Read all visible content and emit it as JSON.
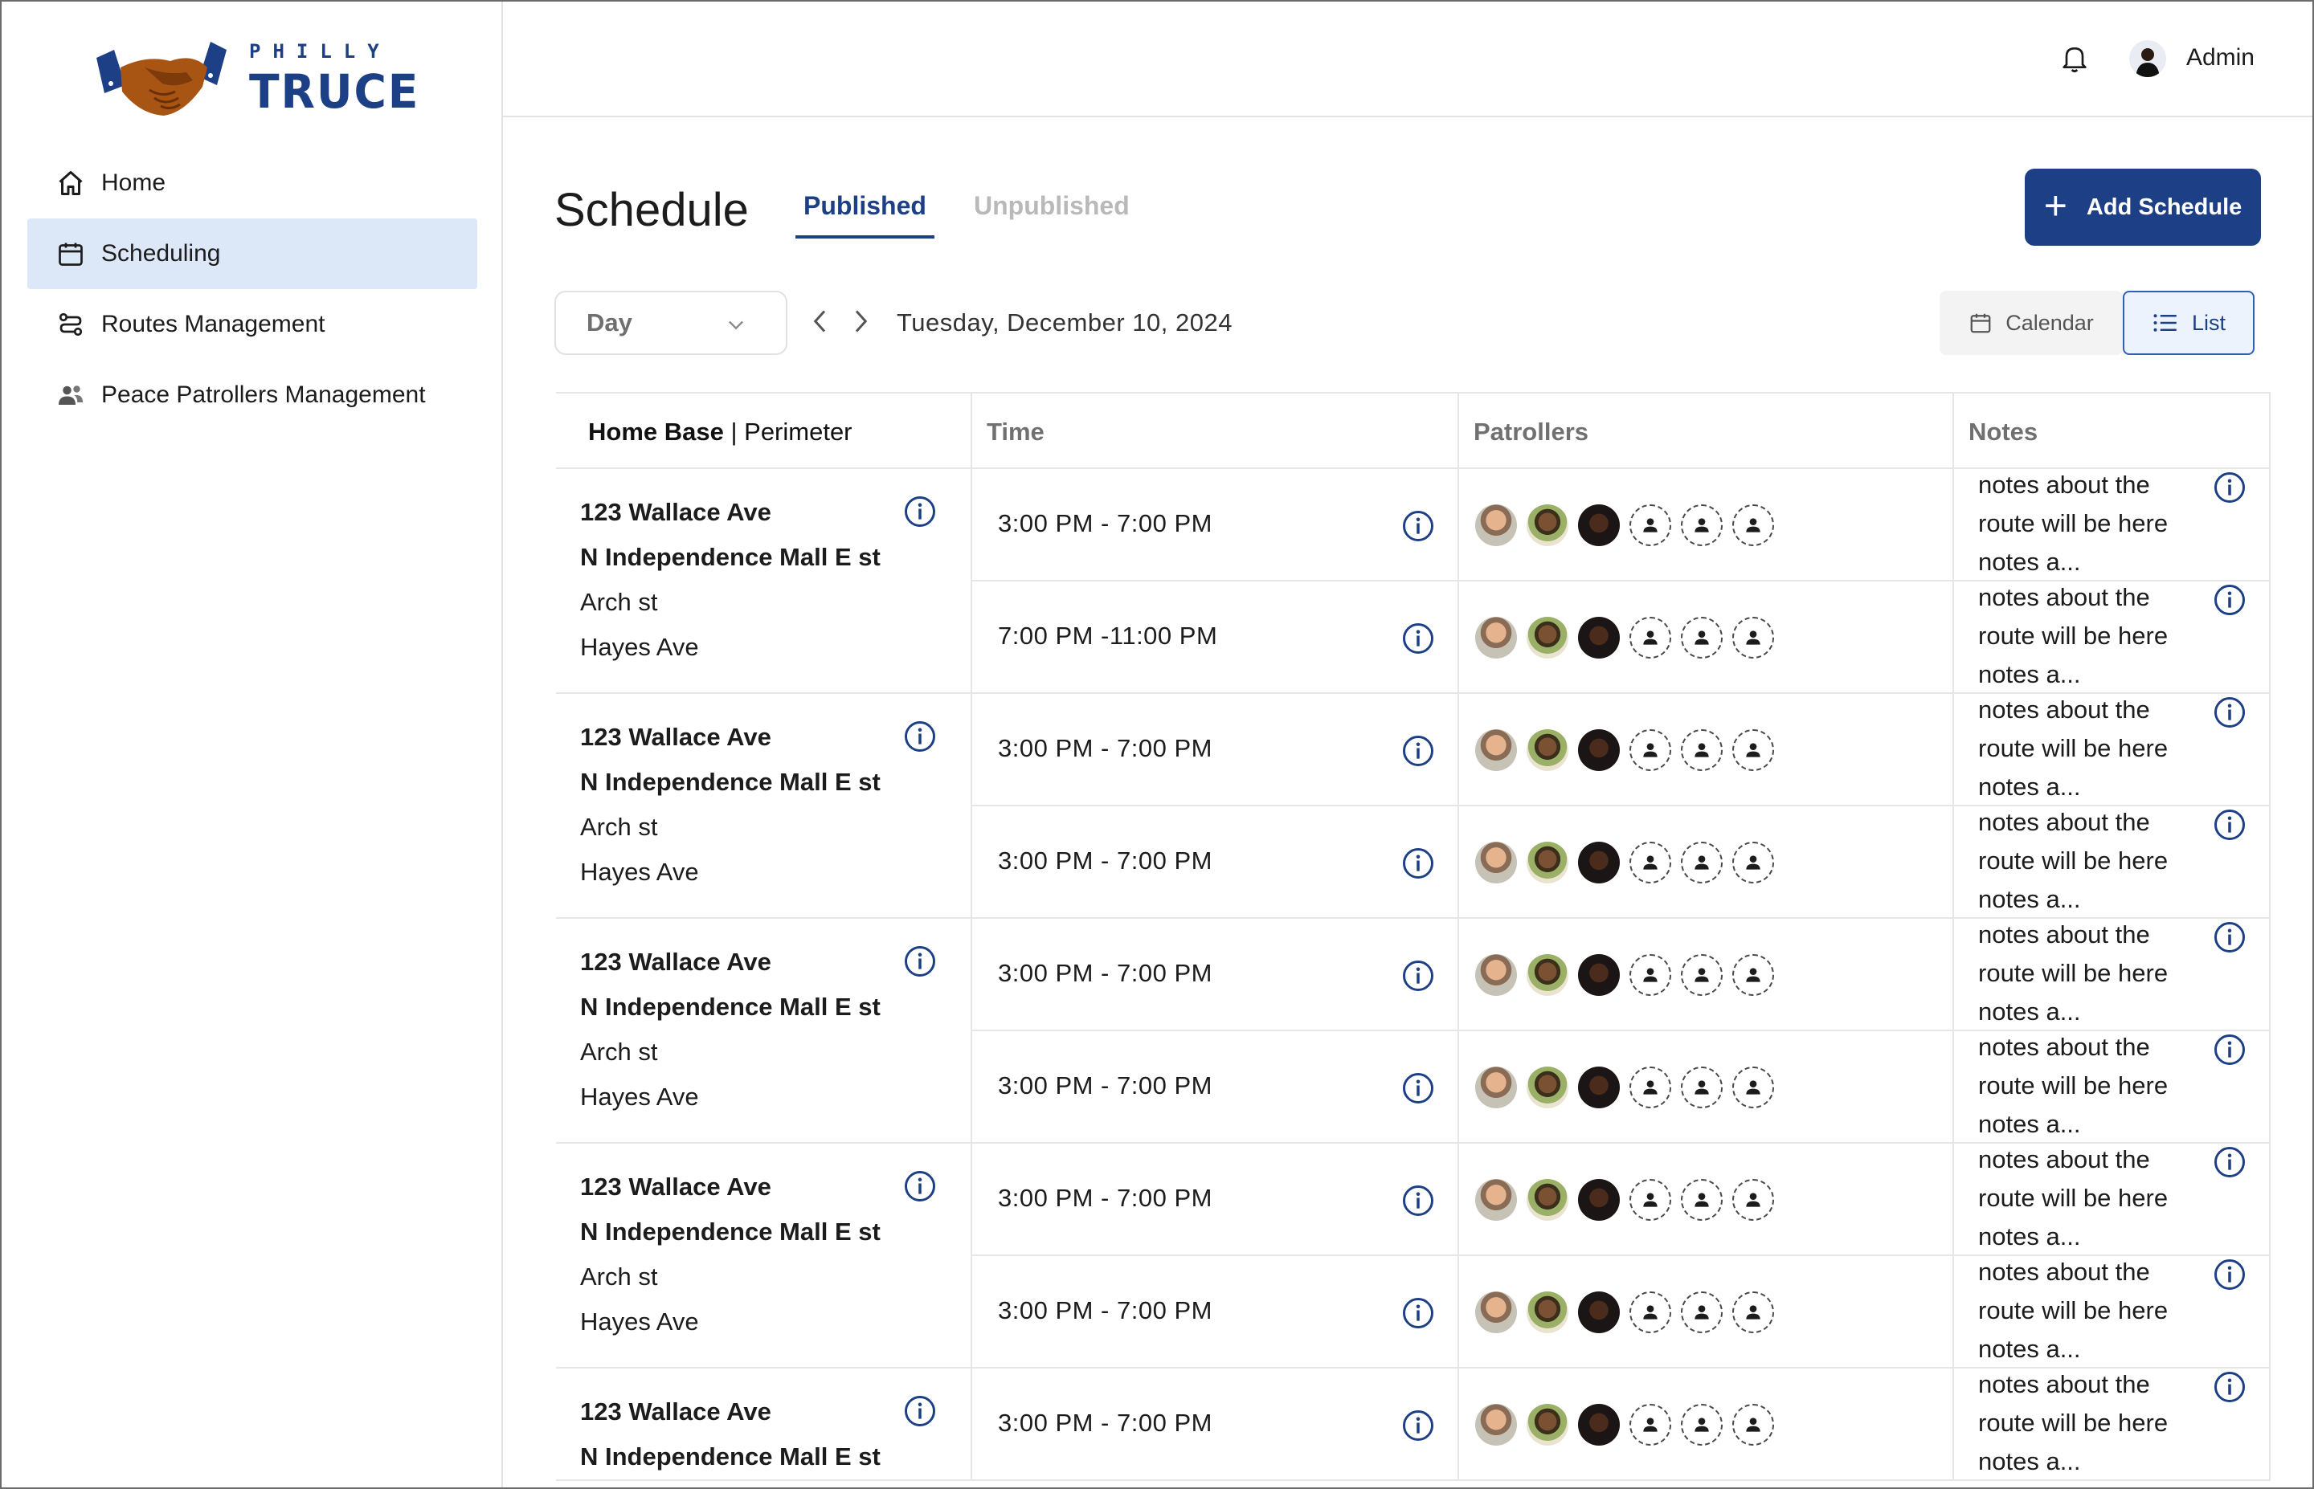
{
  "brand": {
    "line1": "PHILLY",
    "line2": "TRUCE"
  },
  "sidebar": {
    "items": [
      {
        "label": "Home",
        "icon": "home-icon"
      },
      {
        "label": "Scheduling",
        "icon": "calendar-icon",
        "active": true
      },
      {
        "label": "Routes Management",
        "icon": "route-icon"
      },
      {
        "label": "Peace Patrollers Management",
        "icon": "people-icon"
      }
    ]
  },
  "header": {
    "user_name": "Admin"
  },
  "main": {
    "title": "Schedule",
    "tabs": [
      {
        "label": "Published",
        "active": true
      },
      {
        "label": "Unpublished",
        "active": false
      }
    ],
    "add_button": "Add Schedule",
    "period_select": "Day",
    "date": "Tuesday, December 10, 2024",
    "views": {
      "calendar": "Calendar",
      "list": "List",
      "selected": "List"
    }
  },
  "table": {
    "col_home_base": "Home Base",
    "col_sep": " | ",
    "col_perimeter": "Perimeter",
    "col_time": "Time",
    "col_patrollers": "Patrollers",
    "col_notes": "Notes",
    "groups": [
      {
        "route": [
          "123 Wallace Ave",
          "N Independence Mall E st",
          "Arch st",
          "Hayes Ave"
        ],
        "rows": [
          {
            "time": "3:00 PM - 7:00 PM",
            "notes": "notes about the route will be here notes a..."
          },
          {
            "time": "7:00 PM -11:00 PM",
            "notes": "notes about the route will be here notes a..."
          }
        ]
      },
      {
        "route": [
          "123 Wallace Ave",
          "N Independence Mall E st",
          "Arch st",
          "Hayes Ave"
        ],
        "rows": [
          {
            "time": "3:00 PM - 7:00 PM",
            "notes": "notes about the route will be here notes a..."
          },
          {
            "time": "3:00 PM - 7:00 PM",
            "notes": "notes about the route will be here notes a..."
          }
        ]
      },
      {
        "route": [
          "123 Wallace Ave",
          "N Independence Mall E st",
          "Arch st",
          "Hayes Ave"
        ],
        "rows": [
          {
            "time": "3:00 PM - 7:00 PM",
            "notes": "notes about the route will be here notes a..."
          },
          {
            "time": "3:00 PM - 7:00 PM",
            "notes": "notes about the route will be here notes a..."
          }
        ]
      },
      {
        "route": [
          "123 Wallace Ave",
          "N Independence Mall E st",
          "Arch st",
          "Hayes Ave"
        ],
        "rows": [
          {
            "time": "3:00 PM - 7:00 PM",
            "notes": "notes about the route will be here notes a..."
          },
          {
            "time": "3:00 PM - 7:00 PM",
            "notes": "notes about the route will be here notes a..."
          }
        ]
      },
      {
        "route": [
          "123 Wallace Ave",
          "N Independence Mall E st"
        ],
        "rows": [
          {
            "time": "3:00 PM - 7:00 PM",
            "notes": "notes about the route will be here notes a..."
          }
        ]
      }
    ]
  },
  "colors": {
    "brand": "#1c3f86",
    "active_bg": "#dce7f7",
    "border": "#e6e6e6"
  }
}
